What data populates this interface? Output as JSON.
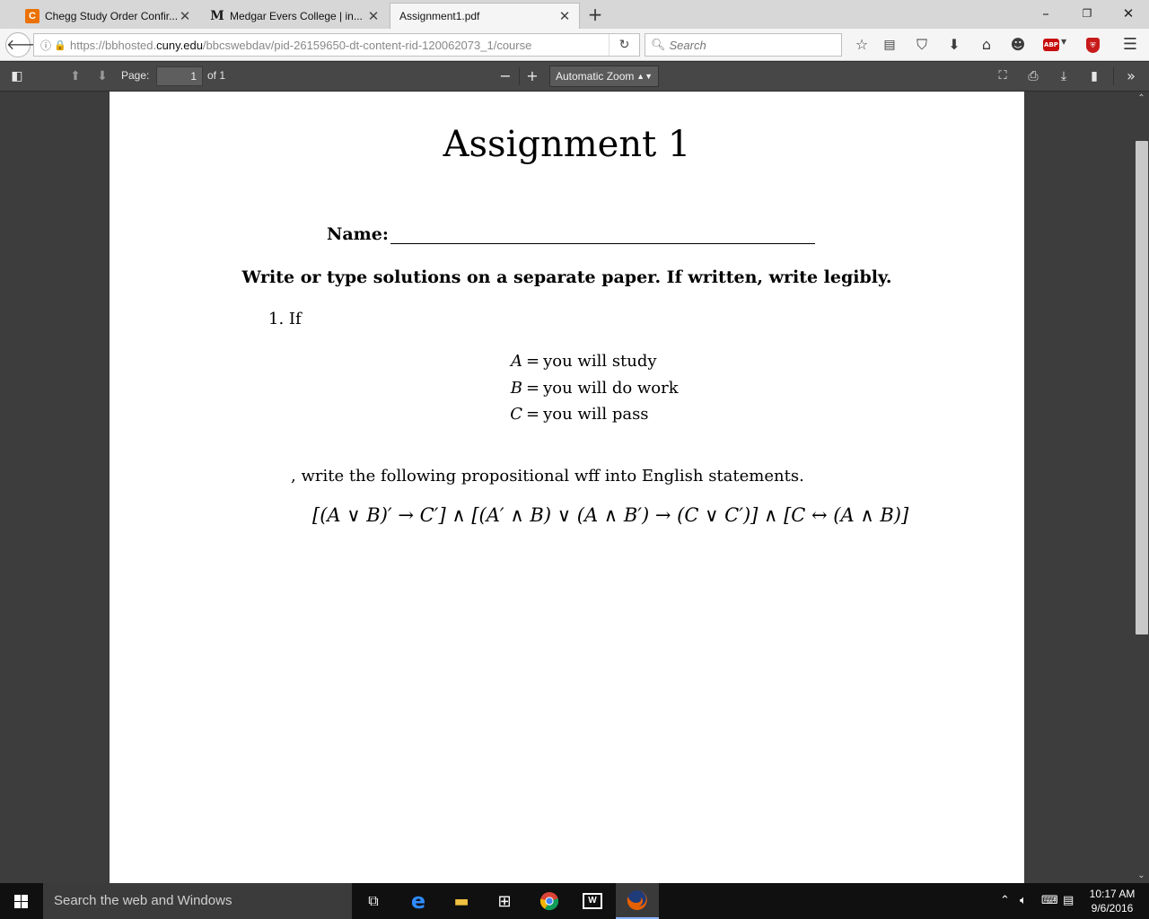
{
  "tabs": [
    {
      "title": "Chegg Study Order Confir...",
      "favicon": "C"
    },
    {
      "title": "Medgar Evers College | in...",
      "favicon": "M"
    },
    {
      "title": "Assignment1.pdf",
      "favicon": ""
    }
  ],
  "window_controls": {
    "minimize": "–",
    "restore": "❐",
    "close": "✕"
  },
  "address": {
    "url_prefix": "https://bbhosted.",
    "url_domain": "cuny.edu",
    "url_path": "/bbcswebdav/pid-26159650-dt-content-rid-120062073_1/course"
  },
  "search": {
    "placeholder": "Search"
  },
  "pdf_toolbar": {
    "page_label": "Page:",
    "page_value": "1",
    "page_of": "of 1",
    "zoom_value": "Automatic Zoom"
  },
  "document": {
    "title": "Assignment 1",
    "name_label": "Name:",
    "instructions": "Write or type solutions on a separate paper. If written, write legibly.",
    "q1_intro": "1.  If",
    "definitions": [
      {
        "var": "A",
        "meaning": "you will study"
      },
      {
        "var": "B",
        "meaning": "you will do work"
      },
      {
        "var": "C",
        "meaning": "you will pass"
      }
    ],
    "q1_task": ",  write the following propositional wff into English statements.",
    "wff": "[(A ∨ B)′ → C′] ∧ [(A′ ∧ B) ∨ (A ∧ B′) → (C ∨ C′)] ∧ [C ↔ (A ∧ B)]"
  },
  "taskbar": {
    "search_placeholder": "Search the web and Windows",
    "time": "10:17 AM",
    "date": "9/6/2016"
  },
  "colors": {
    "chegg": "#eb7100",
    "abp": "#c70d0d",
    "pdf_toolbar": "#474747"
  }
}
